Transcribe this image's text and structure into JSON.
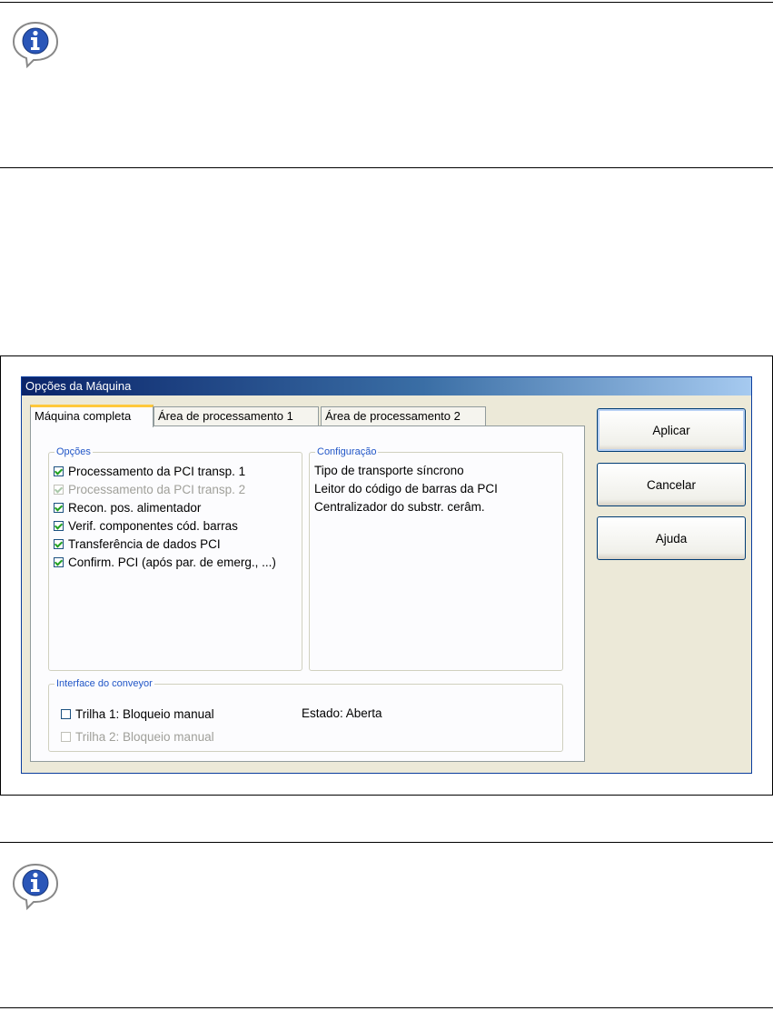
{
  "dialog": {
    "title": "Opções da Máquina",
    "tabs": [
      {
        "label": "Máquina completa",
        "active": true
      },
      {
        "label": "Área de processamento 1",
        "active": false
      },
      {
        "label": "Área de processamento 2",
        "active": false
      }
    ],
    "options_group": {
      "legend": "Opções",
      "items": [
        {
          "label": "Processamento da PCI transp. 1",
          "checked": true,
          "enabled": true
        },
        {
          "label": "Processamento da PCI transp. 2",
          "checked": true,
          "enabled": false
        },
        {
          "label": "Recon. pos. alimentador",
          "checked": true,
          "enabled": true
        },
        {
          "label": "Verif. componentes cód. barras",
          "checked": true,
          "enabled": true
        },
        {
          "label": "Transferência de dados PCI",
          "checked": true,
          "enabled": true
        },
        {
          "label": "Confirm. PCI (após par. de emerg., ...)",
          "checked": true,
          "enabled": true
        }
      ]
    },
    "config_group": {
      "legend": "Configuração",
      "lines": [
        "Tipo de transporte síncrono",
        "Leitor do código de barras da PCI",
        "Centralizador do substr. cerâm."
      ]
    },
    "conveyor_group": {
      "legend": "Interface do conveyor",
      "lane1": {
        "label": "Trilha 1: Bloqueio manual",
        "checked": false,
        "enabled": true
      },
      "lane2": {
        "label": "Trilha 2: Bloqueio manual",
        "checked": false,
        "enabled": false
      },
      "status": "Estado: Aberta"
    },
    "buttons": {
      "apply": "Aplicar",
      "cancel": "Cancelar",
      "help": "Ajuda"
    }
  },
  "icons": {
    "note_icon_top": "info-note-icon",
    "note_icon_bottom": "info-note-icon"
  },
  "colors": {
    "title_bar": "#0a246a",
    "group_legend": "#2156c7",
    "check_mark": "#21a121",
    "active_tab_accent": "#ffc83c"
  }
}
